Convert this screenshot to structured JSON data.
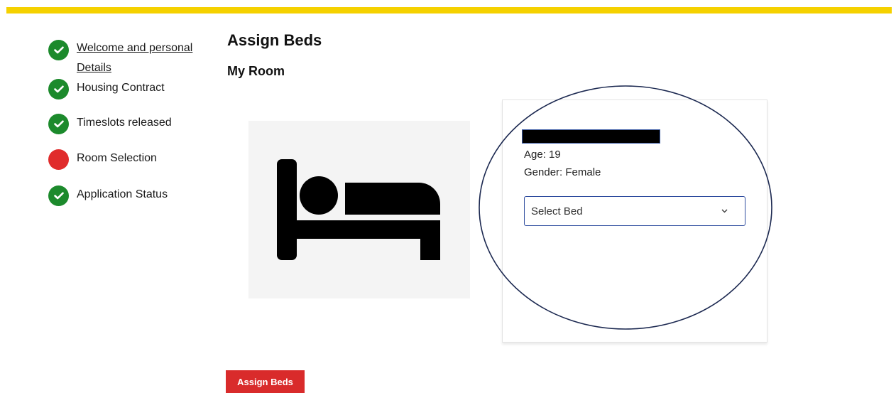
{
  "colors": {
    "brand_yellow": "#f5d100",
    "check_green": "#1c8a2c",
    "current_red": "#e02b2b",
    "button_red": "#d92b2b",
    "select_border": "#2e4c9e",
    "ellipse_stroke": "#1b2850"
  },
  "steps": [
    {
      "label": "Welcome and personal Details",
      "status": "complete",
      "icon": "check-circle-icon",
      "link": true
    },
    {
      "label": "Housing Contract",
      "status": "complete",
      "icon": "check-circle-icon",
      "link": false
    },
    {
      "label": "Timeslots released",
      "status": "complete",
      "icon": "check-circle-icon",
      "link": false
    },
    {
      "label": "Room Selection",
      "status": "current",
      "icon": "red-dot-icon",
      "link": false
    },
    {
      "label": "Application Status",
      "status": "complete",
      "icon": "check-circle-icon",
      "link": false
    }
  ],
  "main": {
    "title": "Assign Beds",
    "subtitle": "My Room",
    "room_image_icon": "bed-icon"
  },
  "occupant": {
    "age_label": "Age: 19",
    "gender_label": "Gender: Female",
    "name_redacted": true,
    "bed_select": {
      "value": "Select Bed",
      "icon": "chevron-down-icon"
    }
  },
  "actions": {
    "assign_label": "Assign Beds"
  }
}
